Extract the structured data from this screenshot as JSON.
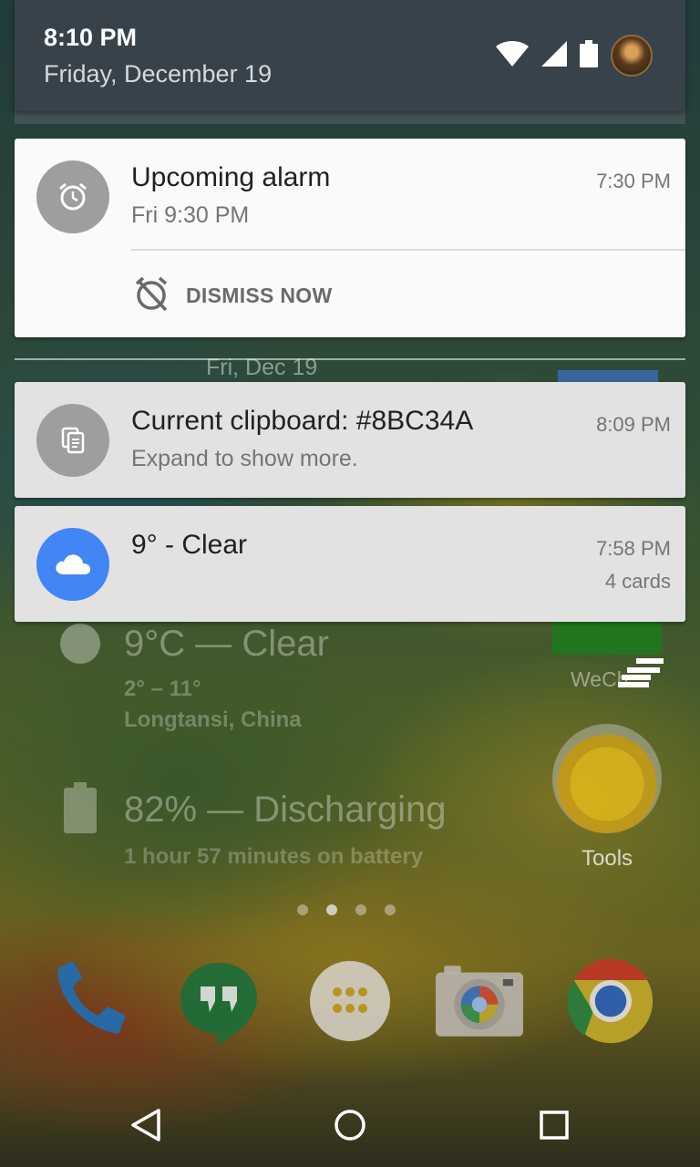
{
  "status_bar": {
    "time": "8:10 PM",
    "date": "Friday, December 19",
    "icons": [
      "wifi-icon",
      "cell-signal-icon",
      "battery-icon",
      "user-avatar"
    ]
  },
  "notifications": [
    {
      "icon": "alarm-clock-icon",
      "icon_color": "#9e9e9e",
      "title": "Upcoming alarm",
      "text": "Fri 9:30 PM",
      "time": "7:30 PM",
      "action": {
        "icon": "alarm-off-icon",
        "label": "DISMISS NOW"
      }
    },
    {
      "icon": "clipboard-icon",
      "icon_color": "#9e9e9e",
      "title": "Current clipboard: #8BC34A",
      "text": "Expand to show more.",
      "time": "8:09 PM"
    },
    {
      "icon": "cloud-icon",
      "icon_color": "#4285f4",
      "title": "9° - Clear",
      "time": "7:58 PM",
      "extra": "4 cards"
    }
  ],
  "section_date": "Fri, Dec 19",
  "home_screen": {
    "weather_main": "9°C — Clear",
    "weather_temps": "2° – 11°",
    "weather_location": "Longtansi, China",
    "battery_main": "82% — Discharging",
    "battery_sub": "1 hour 57 minutes on battery",
    "apps": {
      "wechat": "WeCh",
      "tools": "Tools"
    },
    "page_dots": {
      "count": 4,
      "active": 1
    },
    "dock": [
      "phone-icon",
      "hangouts-icon",
      "app-drawer-icon",
      "camera-icon",
      "chrome-icon"
    ]
  },
  "nav_bar": [
    "back-button",
    "home-button",
    "recents-button"
  ]
}
